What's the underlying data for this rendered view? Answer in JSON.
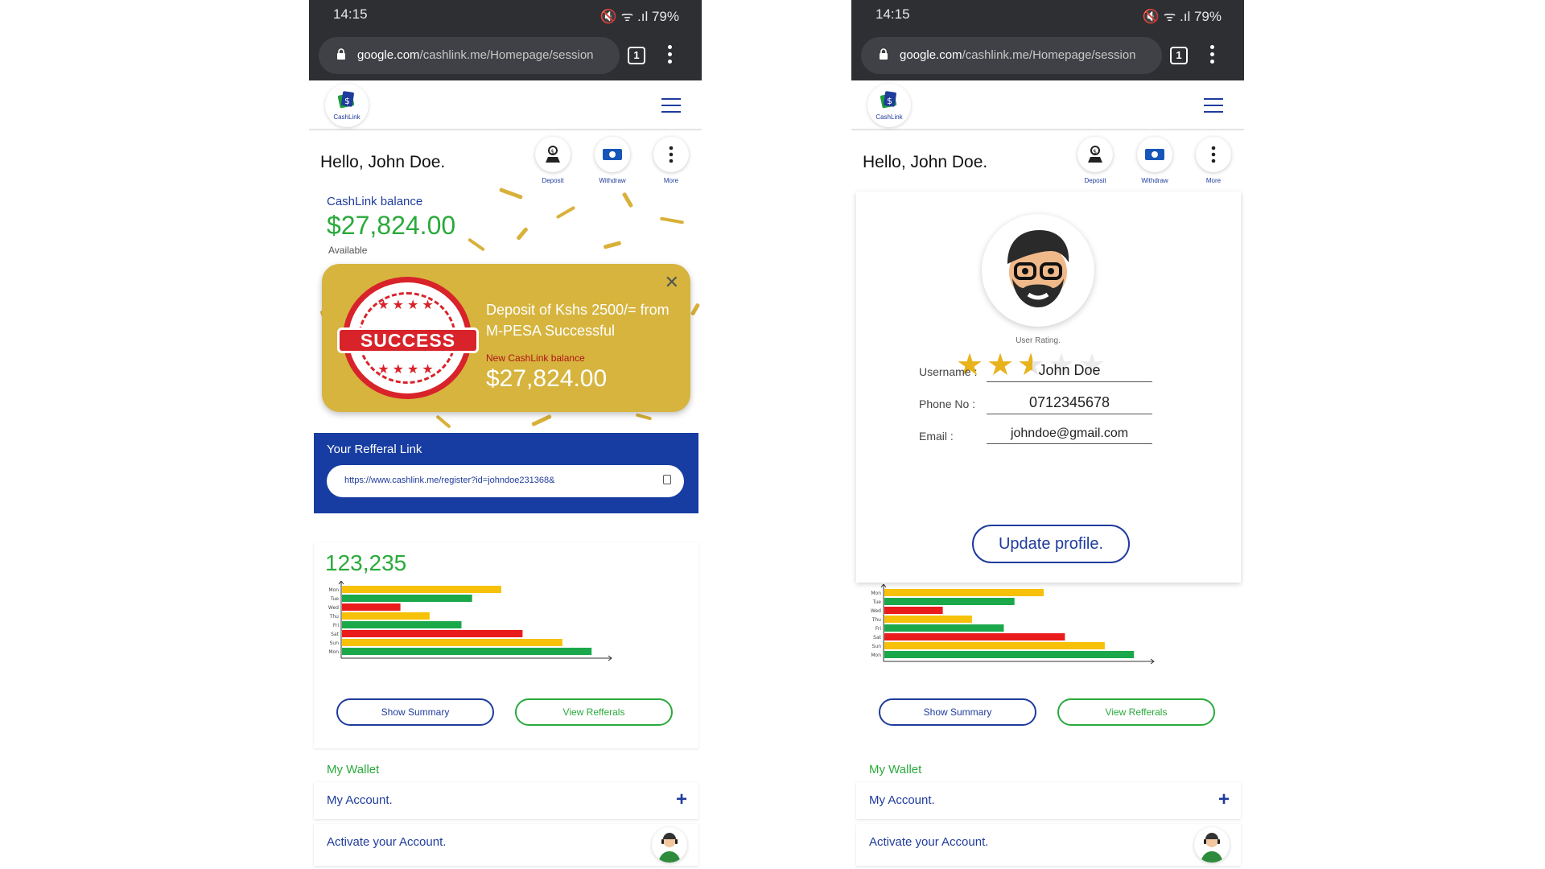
{
  "status": {
    "time": "14:15",
    "battery": "79%",
    "signal_glyphs": "🔇 ᯤ .ıl"
  },
  "browser": {
    "url_host": "google.com",
    "url_path": "/cashlink.me/Homepage/session",
    "tab_count": "1"
  },
  "app": {
    "logo_text": "CashLink",
    "greeting": "Hello, John Doe."
  },
  "quick_actions": {
    "deposit": "Deposit",
    "withdraw": "Withdraw",
    "more": "More"
  },
  "balance": {
    "label": "CashLink balance",
    "amount": "$27,824.00",
    "available": "Available"
  },
  "success_modal": {
    "stamp_text": "SUCCESS",
    "message": "Deposit of Kshs 2500/= from M-PESA Successful",
    "new_balance_label": "New CashLink balance",
    "new_balance_amount": "$27,824.00",
    "close": "✕"
  },
  "referral": {
    "title": "Your Refferal Link",
    "link": "https://www.cashlink.me/register?id=johndoe231368&"
  },
  "stats": {
    "total": "123,235"
  },
  "chart_data": {
    "type": "bar",
    "orientation": "horizontal",
    "categories": [
      "Mon",
      "Tue",
      "Wed",
      "Thu",
      "Fri",
      "Sat",
      "Sun",
      "Mon"
    ],
    "values": [
      6.0,
      4.9,
      2.2,
      3.3,
      4.5,
      6.8,
      8.3,
      9.4
    ],
    "colors": [
      "#f6c108",
      "#1ba84a",
      "#ea1b1b",
      "#f6c108",
      "#1ba84a",
      "#ea1b1b",
      "#f6c108",
      "#1ba84a"
    ],
    "xlim": [
      0,
      10
    ],
    "grid": false,
    "legend": "none"
  },
  "buttons": {
    "show_summary": "Show Summary",
    "view_referrals": "View Refferals"
  },
  "wallet": {
    "title": "My Wallet",
    "my_account": "My Account.",
    "activate": "Activate your Account.",
    "plus": "+"
  },
  "profile": {
    "rating_label": "User Rating.",
    "rating": 2.5,
    "rating_max": 5,
    "username_label": "Username :",
    "username": "John Doe",
    "phone_label": "Phone No :",
    "phone": "0712345678",
    "email_label": "Email :",
    "email": "johndoe@gmail.com",
    "update_button": "Update profile."
  },
  "colors": {
    "brand_blue": "#1f3c9c",
    "green": "#2aaa3b",
    "gold": "#d6b43e",
    "red": "#d8232a",
    "browser_dark": "#2d2f33"
  }
}
